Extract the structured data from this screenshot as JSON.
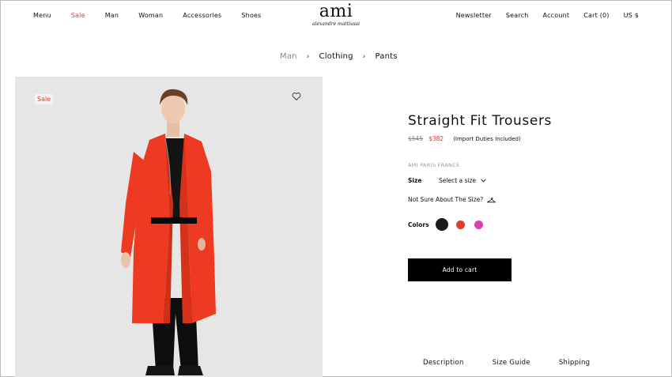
{
  "header": {
    "nav_left": [
      "Menu",
      "Sale",
      "Man",
      "Woman",
      "Accessories",
      "Shoes"
    ],
    "logo": "ami",
    "logo_tagline": "alexandre mattiussi",
    "nav_right": [
      "Newsletter",
      "Search",
      "Account",
      "Cart (0)",
      "US $"
    ]
  },
  "breadcrumb": [
    "Man",
    "Clothing",
    "Pants"
  ],
  "image": {
    "badge": "Sale",
    "wishlist_icon": "heart-icon"
  },
  "product": {
    "title": "Straight Fit Trousers",
    "old_price": "$545",
    "new_price": "$382",
    "duties_note": "(Import Duties Included)",
    "brand_line": "AMI PARIS FRANCE",
    "size_label": "Size",
    "size_placeholder": "Select a size",
    "size_help": "Not Sure About The Size?",
    "colors_label": "Colors",
    "colors": [
      "#1b1b1b",
      "#e8392b",
      "#de3fb3"
    ],
    "add_to_cart": "Add to cart"
  },
  "tabs": [
    "Description",
    "Size Guide",
    "Shipping"
  ],
  "colors": {
    "accent_sale": "#e8392b",
    "button_bg": "#000000",
    "image_bg": "#e6e6e6"
  }
}
